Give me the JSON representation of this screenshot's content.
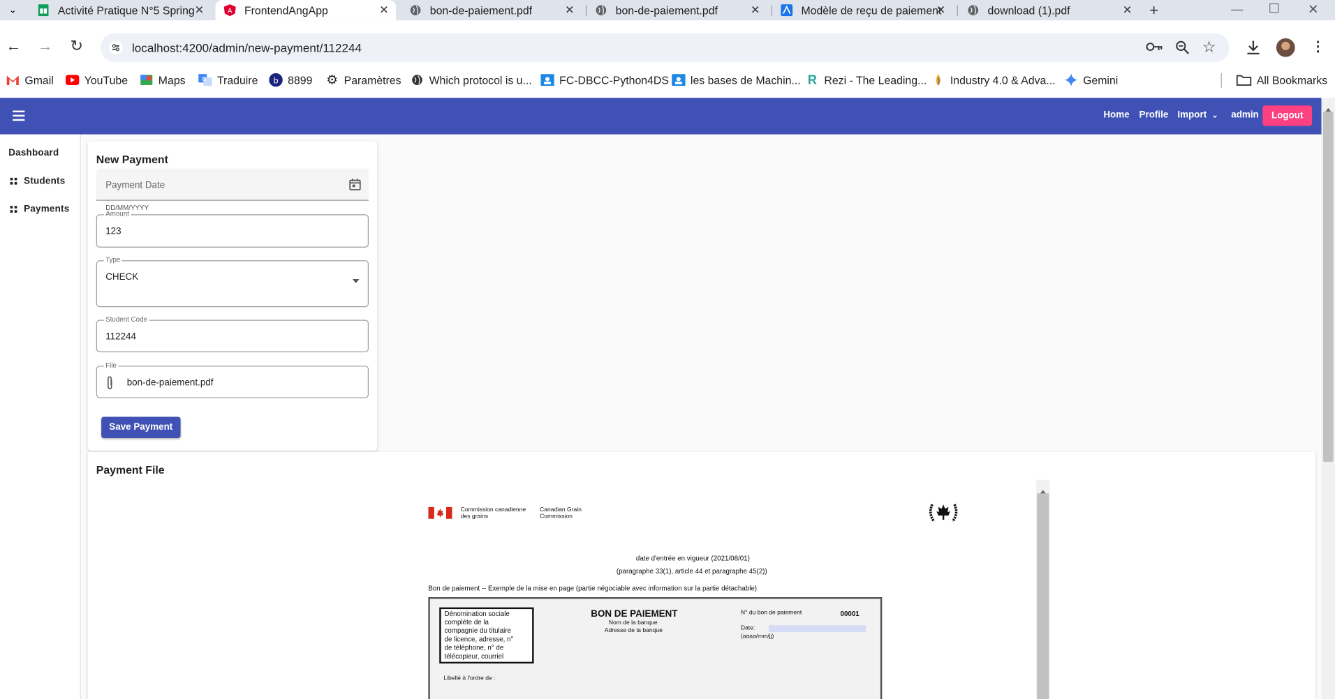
{
  "browser": {
    "tabs": [
      {
        "title": "Activité Pratique N°5 Spring",
        "icon": "sheets-icon",
        "active": false
      },
      {
        "title": "FrontendAngApp",
        "icon": "angular-icon",
        "active": true
      },
      {
        "title": "bon-de-paiement.pdf",
        "icon": "globe-icon",
        "active": false
      },
      {
        "title": "bon-de-paiement.pdf",
        "icon": "globe-icon",
        "active": false
      },
      {
        "title": "Modèle de reçu de paiement",
        "icon": "app-icon",
        "active": false
      },
      {
        "title": "download (1).pdf",
        "icon": "globe-icon",
        "active": false
      }
    ],
    "url": "localhost:4200/admin/new-payment/112244",
    "bookmarks": [
      {
        "label": "Gmail",
        "icon": "gmail-icon"
      },
      {
        "label": "YouTube",
        "icon": "youtube-icon"
      },
      {
        "label": "Maps",
        "icon": "maps-icon"
      },
      {
        "label": "Traduire",
        "icon": "translate-icon"
      },
      {
        "label": "8899",
        "icon": "b-icon"
      },
      {
        "label": "Paramètres",
        "icon": "gear-icon"
      },
      {
        "label": "Which protocol is u...",
        "icon": "globe-icon"
      },
      {
        "label": "FC-DBCC-Python4DS",
        "icon": "classroom-icon"
      },
      {
        "label": "les bases de Machin...",
        "icon": "classroom-icon"
      },
      {
        "label": "Rezi - The Leading...",
        "icon": "rezi-icon"
      },
      {
        "label": "Industry 4.0 & Adva...",
        "icon": "drop-icon"
      },
      {
        "label": "Gemini",
        "icon": "gemini-icon"
      }
    ],
    "all_bookmarks": "All Bookmarks"
  },
  "header": {
    "nav": [
      "Home",
      "Profile",
      "Import",
      "admin"
    ],
    "logout": "Logout"
  },
  "sidebar": {
    "items": [
      {
        "label": "Dashboard"
      },
      {
        "label": "Students"
      },
      {
        "label": "Payments"
      }
    ]
  },
  "form": {
    "title": "New Payment",
    "payment_date": {
      "placeholder": "Payment Date",
      "hint": "DD/MM/YYYY"
    },
    "amount": {
      "label": "Amount",
      "value": "123"
    },
    "type": {
      "label": "Type",
      "value": "CHECK"
    },
    "student_code": {
      "label": "Student Code",
      "value": "112244"
    },
    "file": {
      "label": "File",
      "value": "bon-de-paiement.pdf"
    },
    "save_label": "Save Payment"
  },
  "payment_file": {
    "title": "Payment File",
    "pdf": {
      "org_fr": [
        "Commission canadienne",
        "des grains"
      ],
      "org_en": [
        "Canadian Grain",
        "Commission"
      ],
      "line1": "date d'entrée en vigueur (2021/08/01)",
      "line2": "(paragraphe 33(1), article 44 et paragraphe 45(2))",
      "line3": "Bon de paiement -- Exemple de la mise en page (partie négociable avec information sur la partie détachable)",
      "box_text": [
        "Dénomination sociale",
        "complète de la",
        "compagnie du titulaire",
        "de licence, adresse, n°",
        "de téléphone, n° de",
        "télécopieur, courriel"
      ],
      "heading": "BON DE PAIEMENT",
      "bank_name": "Nom de la banque",
      "bank_address": "Adresse de la banque",
      "voucher_label": "N° du bon de paiement",
      "voucher_no": "00001",
      "date_label": "Date:",
      "date_format": "(aaaa/mm/jj)",
      "payee_label": "Libellé à l'ordre de :"
    }
  }
}
